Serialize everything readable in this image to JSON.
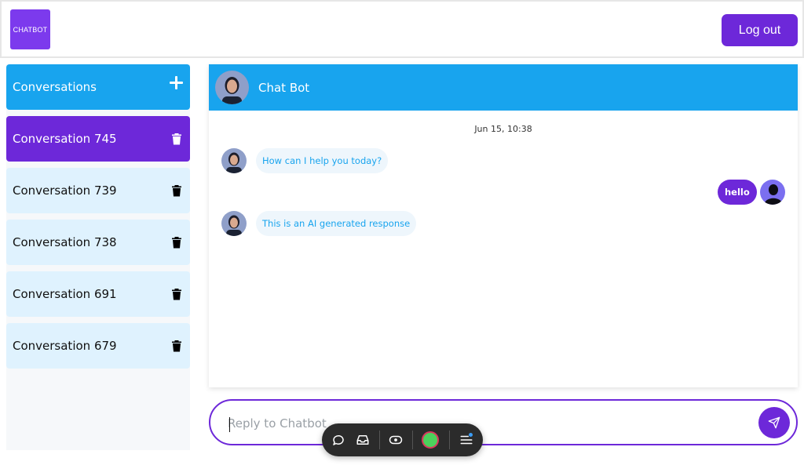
{
  "header": {
    "logo_text": "CHATBOT",
    "logout_label": "Log out"
  },
  "sidebar": {
    "title": "Conversations",
    "add_icon": "plus-icon",
    "items": [
      {
        "label": "Conversation 745",
        "active": true,
        "icon": "trash-icon"
      },
      {
        "label": "Conversation 739",
        "active": false,
        "icon": "trash-icon"
      },
      {
        "label": "Conversation 738",
        "active": false,
        "icon": "trash-icon"
      },
      {
        "label": "Conversation 691",
        "active": false,
        "icon": "trash-icon"
      },
      {
        "label": "Conversation 679",
        "active": false,
        "icon": "trash-icon"
      }
    ]
  },
  "chat": {
    "title": "Chat Bot",
    "date": "Jun 15, 10:38",
    "messages": [
      {
        "from": "bot",
        "text": "How can I help you today?"
      },
      {
        "from": "user",
        "text": "hello"
      },
      {
        "from": "bot",
        "text": "This is an AI generated response"
      }
    ]
  },
  "composer": {
    "placeholder": "Reply to Chatbot",
    "value": "",
    "send_icon": "send-icon"
  },
  "toolbar": {
    "icons": [
      "chat-bubble-icon",
      "inbox-icon",
      "eye-toggle-icon",
      "status-dot-icon",
      "menu-icon"
    ]
  },
  "colors": {
    "brand_purple": "#6d28d9",
    "accent_blue": "#18a4ee",
    "conversation_bg": "#dff2fe",
    "status_green": "#4cd05c"
  }
}
